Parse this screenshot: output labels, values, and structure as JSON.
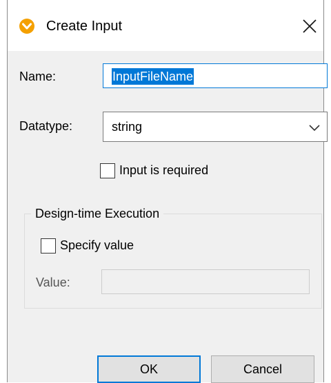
{
  "window": {
    "title": "Create Input",
    "app_icon": "mapforce-logo-icon",
    "close_icon": "close-icon"
  },
  "form": {
    "name_label": "Name:",
    "name_value": "InputFileName",
    "datatype_label": "Datatype:",
    "datatype_value": "string",
    "datatype_icon": "chevron-down-icon",
    "required_label": "Input is required",
    "required_checked": false
  },
  "design_time": {
    "group_title": "Design-time Execution",
    "specify_label": "Specify value",
    "specify_checked": false,
    "value_label": "Value:",
    "value_text": ""
  },
  "buttons": {
    "ok_label": "OK",
    "cancel_label": "Cancel"
  },
  "colors": {
    "accent": "#0078d7",
    "icon_orange": "#f4a000",
    "dialog_bg": "#f0f0f0"
  }
}
